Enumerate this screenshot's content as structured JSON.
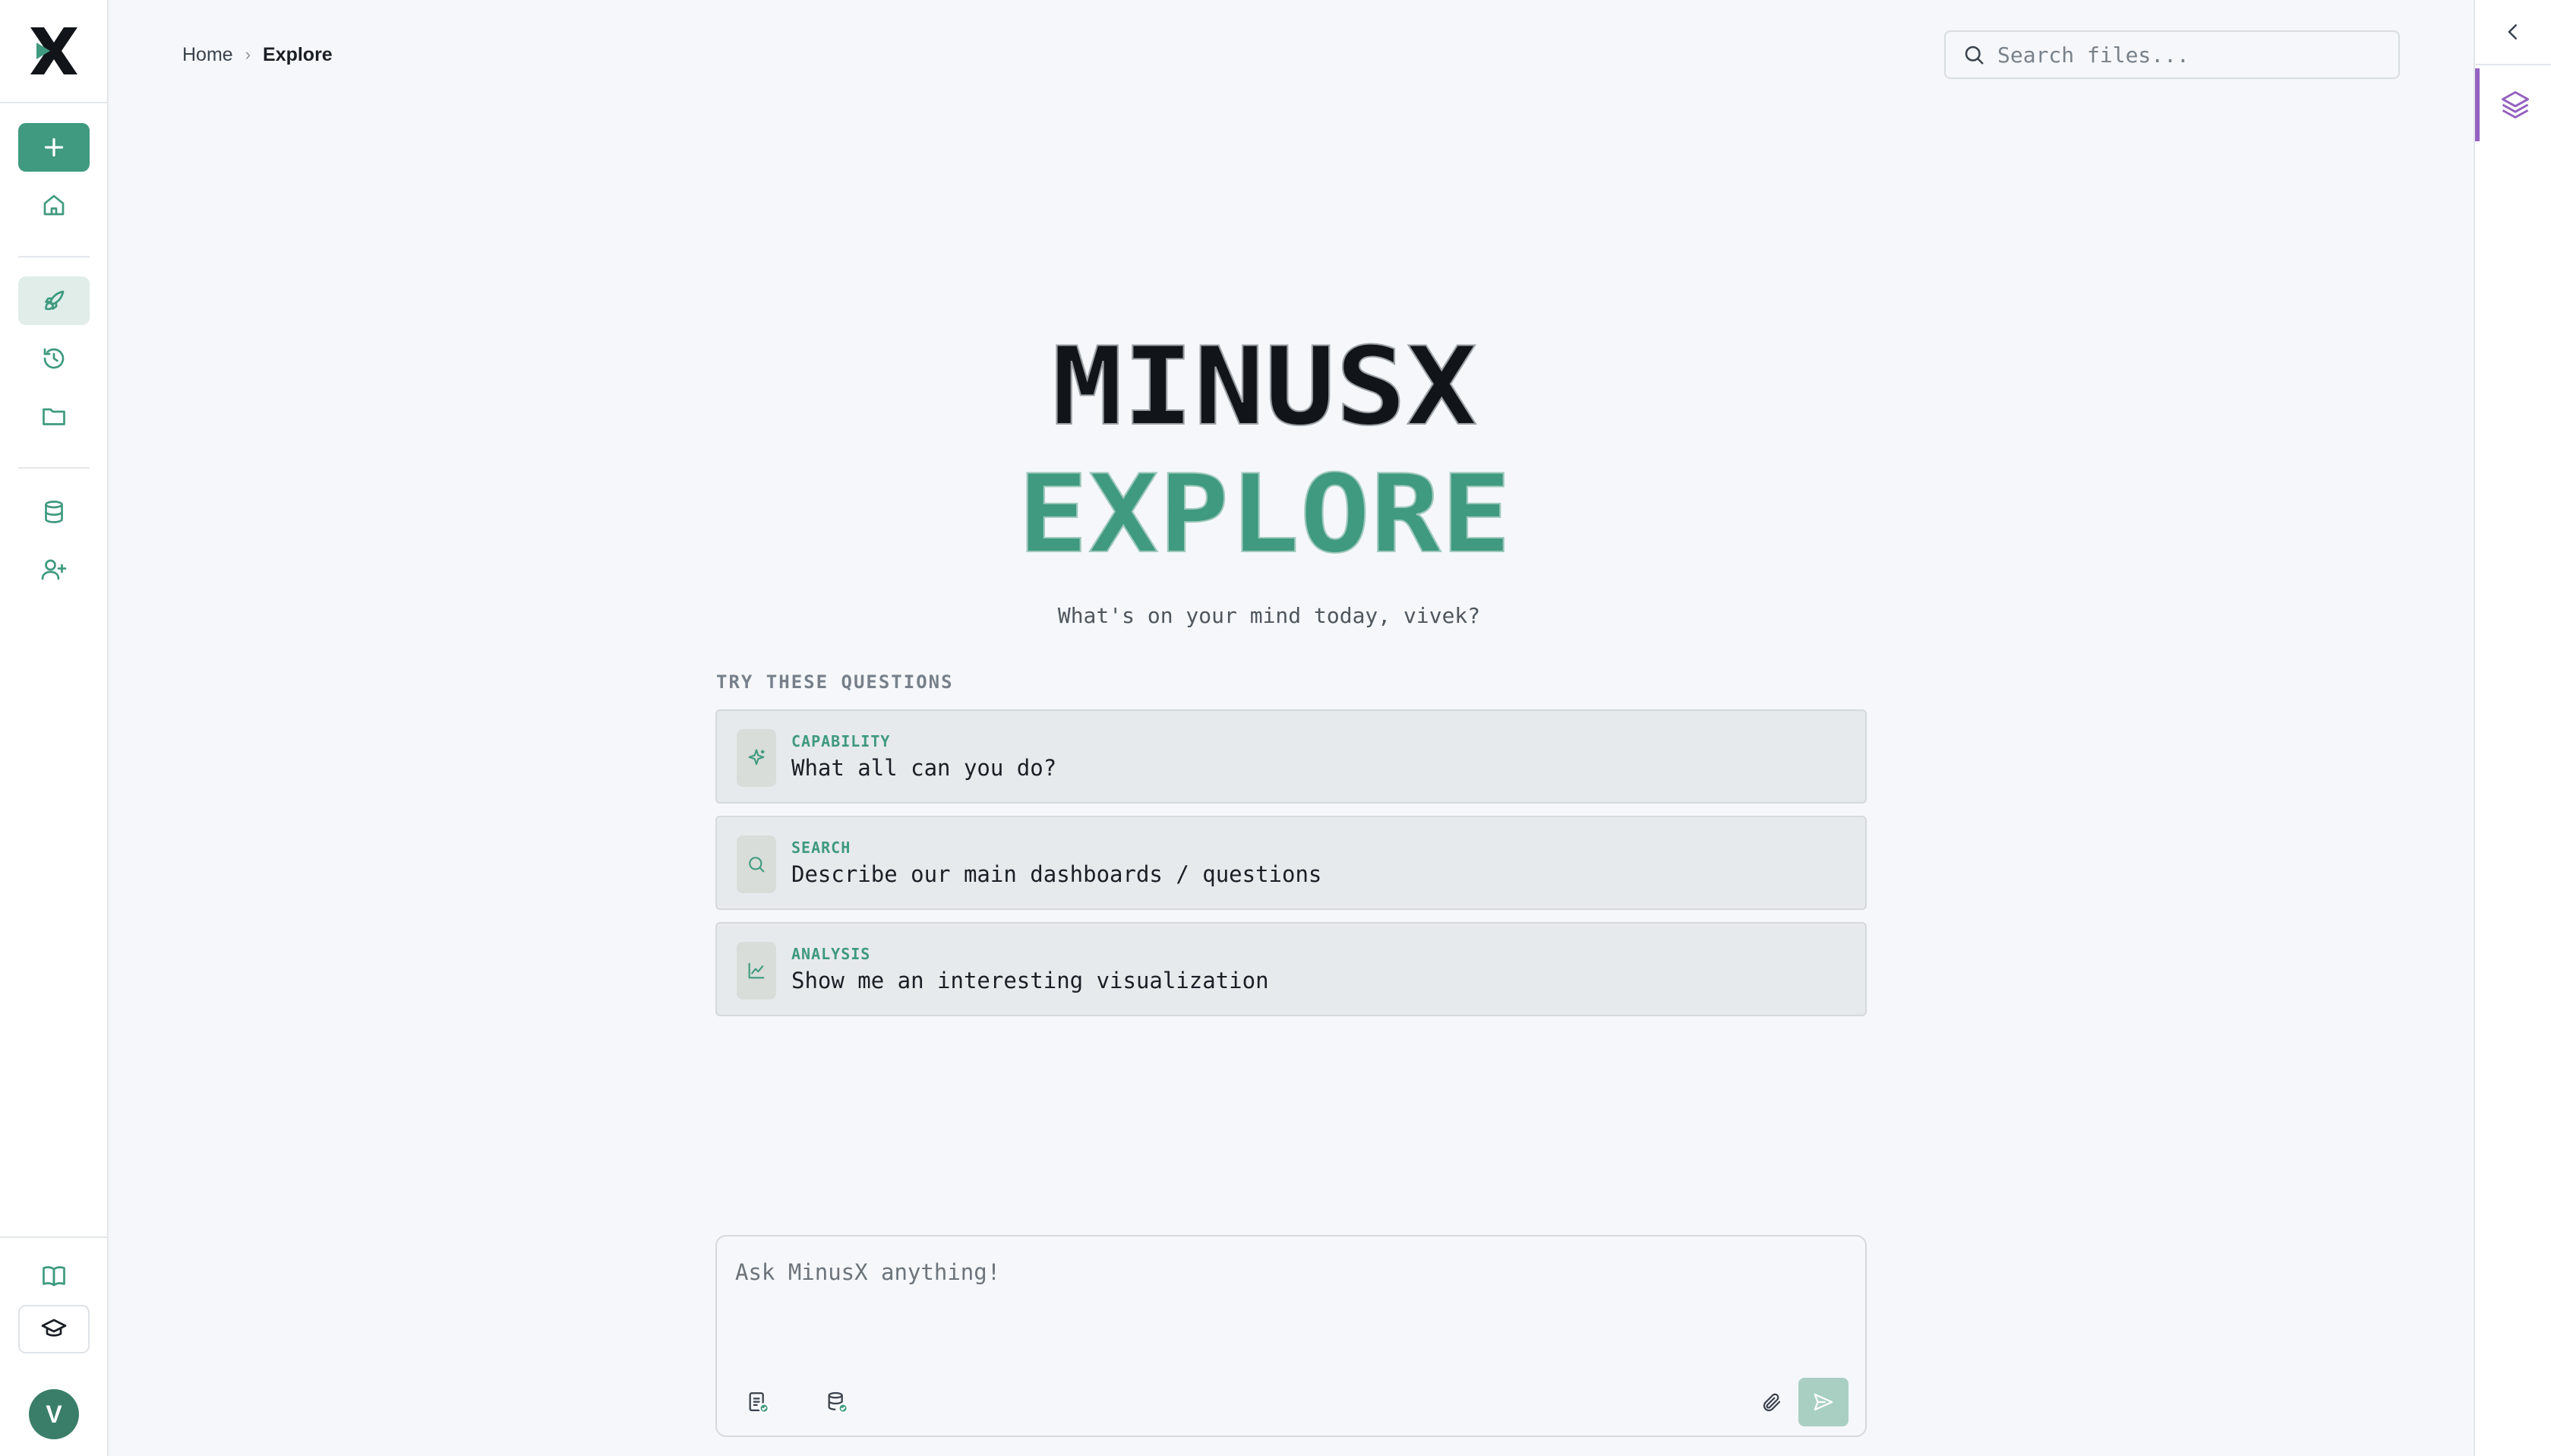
{
  "app": {
    "logo_letter": "X",
    "name": "MinusX"
  },
  "breadcrumb": {
    "home": "Home",
    "separator": "›",
    "current": "Explore"
  },
  "search": {
    "placeholder": "Search files..."
  },
  "hero": {
    "line1": "MINUSX",
    "line2": "EXPLORE",
    "accent_color": "#3f9a7f"
  },
  "tagline": "What's on your mind today, vivek?",
  "suggestions": {
    "heading": "TRY THESE QUESTIONS",
    "items": [
      {
        "tag": "CAPABILITY",
        "text": "What all can you do?",
        "icon": "sparkle-icon"
      },
      {
        "tag": "SEARCH",
        "text": "Describe our main dashboards / questions",
        "icon": "search-icon"
      },
      {
        "tag": "ANALYSIS",
        "text": "Show me an interesting visualization",
        "icon": "chart-icon"
      }
    ]
  },
  "chat": {
    "placeholder": "Ask MinusX anything!"
  },
  "user": {
    "initial": "V"
  },
  "sidebar": {
    "items": [
      "plus-icon",
      "home-icon",
      "rocket-icon",
      "history-icon",
      "folder-icon",
      "database-icon",
      "user-plus-icon",
      "book-icon",
      "graduation-cap-icon"
    ]
  },
  "colors": {
    "brand": "#3f9a7f",
    "panel_accent": "#9462bf",
    "background": "#f5f7fa"
  }
}
